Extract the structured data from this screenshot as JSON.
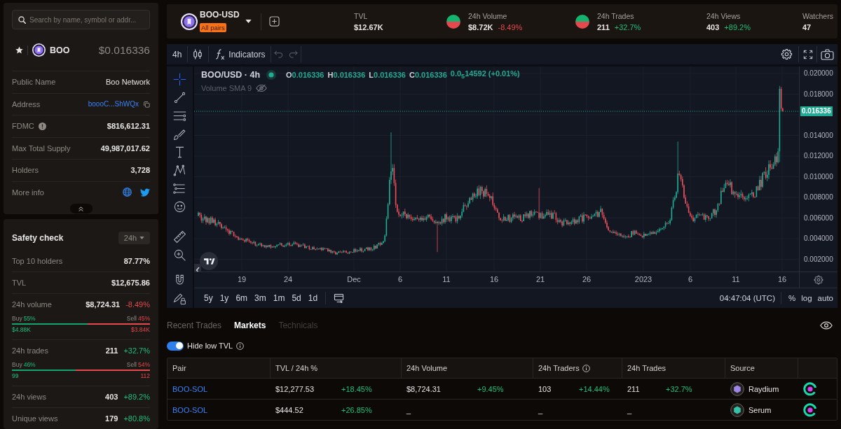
{
  "search": {
    "placeholder": "Search by name, symbol or addr..."
  },
  "token": {
    "symbol": "BOO",
    "price": "$0.016336"
  },
  "token_info": [
    {
      "kind": "text",
      "label": "Public Name",
      "value": "Boo Network"
    },
    {
      "kind": "address",
      "label": "Address",
      "value": "boooC...ShWQx"
    },
    {
      "kind": "info",
      "label": "FDMC",
      "value": "$816,612.31"
    },
    {
      "kind": "number",
      "label": "Max Total Supply",
      "value": "49,987,017.62"
    },
    {
      "kind": "number",
      "label": "Holders",
      "value": "3,728"
    },
    {
      "kind": "links",
      "label": "More info"
    }
  ],
  "safety_check": {
    "title": "Safety check",
    "period": "24h",
    "rows": [
      {
        "kind": "plain",
        "label": "Top 10 holders",
        "value": "87.77%"
      },
      {
        "kind": "plain",
        "label": "TVL",
        "value": "$12,675.86"
      },
      {
        "kind": "split",
        "label": "24h volume",
        "value": "$8,724.31",
        "change": "-8.49%",
        "color": "#e5484d",
        "buy_label": "Buy",
        "buy_share": "55%",
        "sell_label": "Sell",
        "sell_share": "45%",
        "level": 0.55,
        "buy_amount": "$4.88K",
        "sell_amount": "$3.84K"
      },
      {
        "kind": "split",
        "label": "24h trades",
        "value": "211",
        "change": "+32.7%",
        "color": "#1fbf7a",
        "buy_label": "Buy",
        "buy_share": "46%",
        "sell_label": "Sell",
        "sell_share": "54%",
        "level": 0.46,
        "buy_amount": "99",
        "sell_amount": "112"
      },
      {
        "kind": "change",
        "label": "24h views",
        "value": "403",
        "change": "+89.2%",
        "color": "#1fbf7a"
      },
      {
        "kind": "change",
        "label": "Unique views",
        "value": "179",
        "change": "+80.8%",
        "color": "#1fbf7a"
      }
    ]
  },
  "header": {
    "pair": "BOO-USD",
    "badge": "All pairs",
    "stats": [
      {
        "kind": "plain",
        "label": "TVL",
        "value": "$12.67K"
      },
      {
        "kind": "pie",
        "label": "24h Volume",
        "value": "$8.72K",
        "change": "-8.49%",
        "color": "#e5484d"
      },
      {
        "kind": "pie",
        "label": "24h Trades",
        "value": "211",
        "change": "+32.7%",
        "color": "#1fbf7a"
      },
      {
        "kind": "plain",
        "label": "24h Views",
        "value": "403",
        "change": "+89.2%",
        "color": "#1fbf7a"
      },
      {
        "kind": "plain",
        "label": "Watchers",
        "value": "47"
      }
    ]
  },
  "chart": {
    "interval": "4h",
    "indicators": "Indicators",
    "tools": [
      {
        "kind": "crosshair",
        "selected": true
      },
      {
        "kind": "trend_line",
        "selected": false
      },
      {
        "kind": "lines",
        "selected": false
      },
      {
        "kind": "brush",
        "selected": false
      },
      {
        "kind": "text",
        "selected": false
      },
      {
        "kind": "pattern",
        "selected": false
      },
      {
        "kind": "forecast",
        "selected": false
      },
      {
        "kind": "emoji",
        "selected": false
      },
      {
        "kind": "ruler",
        "selected": false
      },
      {
        "kind": "zoom",
        "selected": false
      },
      {
        "kind": "magnet",
        "selected": false
      },
      {
        "kind": "lock",
        "selected": false
      }
    ],
    "legend": {
      "title": "BOO/USD · 4h",
      "ohlc": [
        {
          "key": "O",
          "value": "0.016336"
        },
        {
          "key": "H",
          "value": "0.016336"
        },
        {
          "key": "L",
          "value": "0.016336"
        },
        {
          "key": "C",
          "value": "0.016336"
        }
      ],
      "change": "0.0$_{5}$14592 (+0.01%)",
      "study": "Volume SMA 9"
    },
    "price_axis": [
      {
        "kind": "tick",
        "label": "0.020000"
      },
      {
        "kind": "tick",
        "label": "0.018000"
      },
      {
        "kind": "current",
        "label": "0.016336"
      },
      {
        "kind": "tick",
        "label": "0.014000"
      },
      {
        "kind": "tick",
        "label": "0.012000"
      },
      {
        "kind": "tick",
        "label": "0.010000"
      },
      {
        "kind": "tick",
        "label": "0.008000"
      },
      {
        "kind": "tick",
        "label": "0.006000"
      },
      {
        "kind": "tick",
        "label": "0.004000"
      },
      {
        "kind": "tick",
        "label": "0.002000"
      }
    ],
    "time_axis": [
      "19",
      "24",
      "Dec",
      "6",
      "11",
      "16",
      "21",
      "26",
      "2023",
      "6",
      "11",
      "16"
    ],
    "ranges": [
      "5y",
      "1y",
      "6m",
      "3m",
      "1m",
      "5d",
      "1d"
    ],
    "clock": "04:47:04 (UTC)",
    "scales": [
      "%",
      "log",
      "auto"
    ]
  },
  "tabs": [
    {
      "label": "Recent Trades",
      "selected": false,
      "disabled": false
    },
    {
      "label": "Markets",
      "selected": true,
      "disabled": false
    },
    {
      "label": "Technicals",
      "selected": false,
      "disabled": true
    }
  ],
  "toggle": {
    "label": "Hide low TVL",
    "on": true
  },
  "table": {
    "columns": [
      {
        "kind": "plain",
        "label": "Pair"
      },
      {
        "kind": "plain",
        "label": "TVL / 24h %"
      },
      {
        "kind": "plain",
        "label": "24h Volume"
      },
      {
        "kind": "info",
        "label": "24h Traders"
      },
      {
        "kind": "plain",
        "label": "24h Trades"
      },
      {
        "kind": "plain",
        "label": "Source"
      }
    ],
    "rows": [
      {
        "cells": [
          {
            "kind": "link",
            "text": "BOO-SOL"
          },
          {
            "kind": "metric",
            "text": "$12,277.53",
            "change": "+18.45%"
          },
          {
            "kind": "metric",
            "text": "$8,724.31",
            "change": "+9.45%"
          },
          {
            "kind": "metric",
            "text": "103",
            "change": "+14.44%"
          },
          {
            "kind": "metric",
            "text": "211",
            "change": "+32.7%"
          },
          {
            "kind": "source",
            "text": "Raydium",
            "color": "#9d86e8"
          }
        ]
      },
      {
        "cells": [
          {
            "kind": "link",
            "text": "BOO-SOL"
          },
          {
            "kind": "metric",
            "text": "$444.52",
            "change": "+26.85%"
          },
          {
            "kind": "metric",
            "text": "_"
          },
          {
            "kind": "metric",
            "text": "_"
          },
          {
            "kind": "metric",
            "text": "_"
          },
          {
            "kind": "source",
            "text": "Serum",
            "color": "#36c2a8"
          }
        ]
      }
    ]
  }
}
